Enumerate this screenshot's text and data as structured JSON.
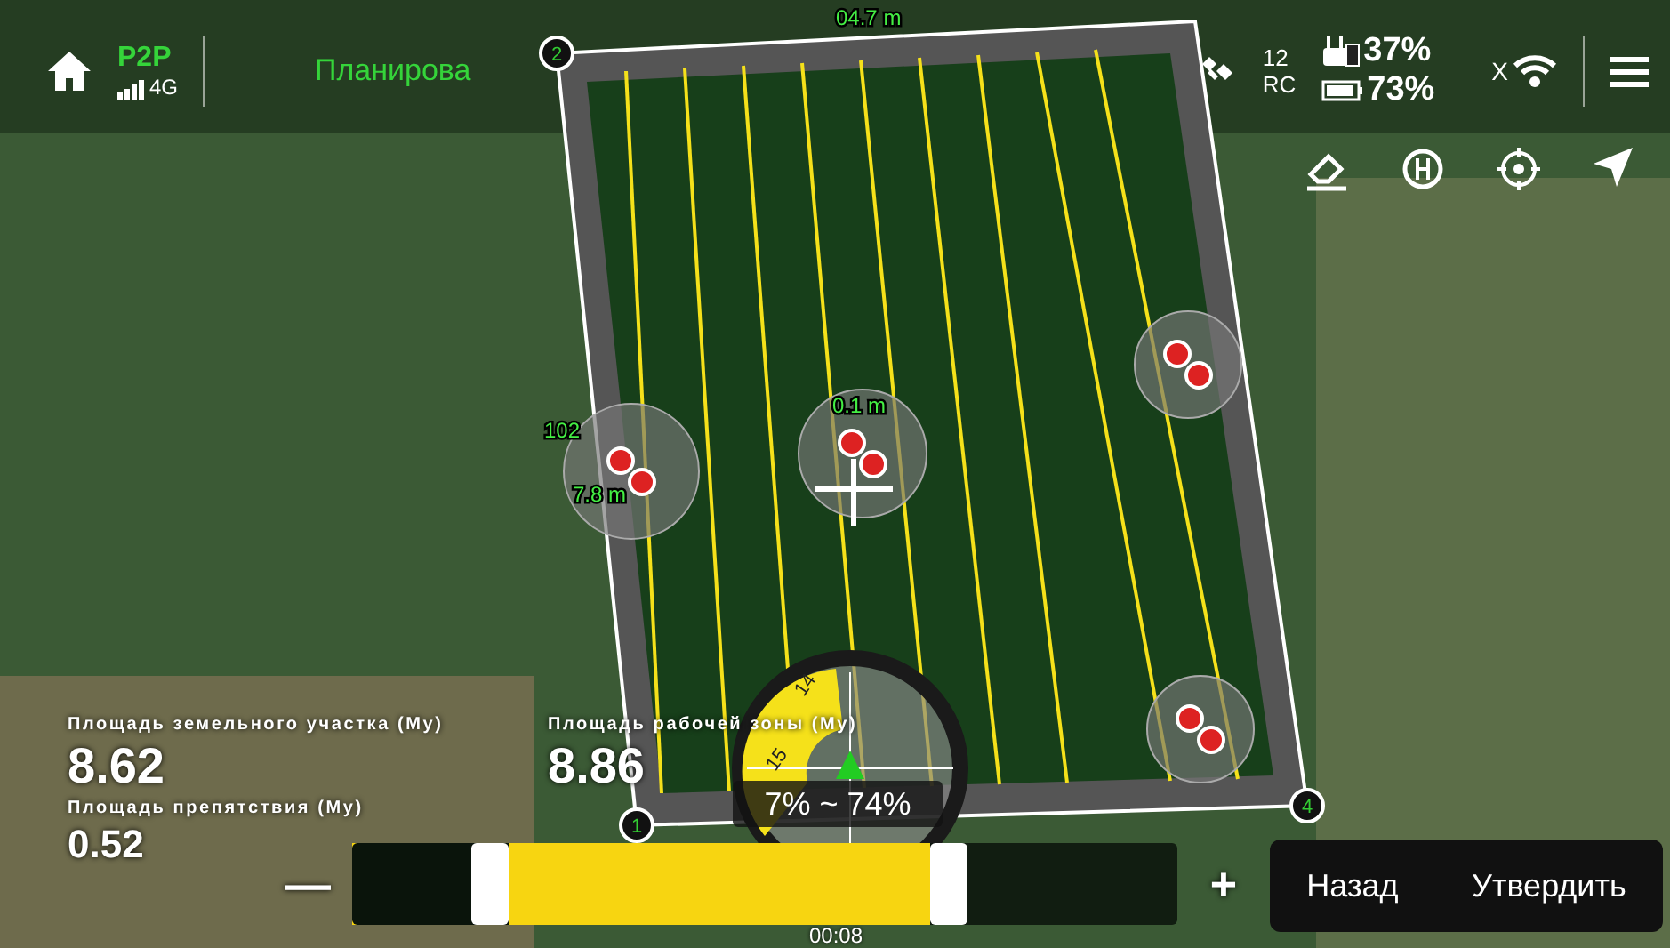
{
  "status_bar": {
    "link": "P2P",
    "network": "4G",
    "title": "Планирова",
    "satellites": "12",
    "rc_label": "RC",
    "rc_battery": "37%",
    "drone_battery": "73%",
    "wifi_prefix": "X"
  },
  "map": {
    "vertices": [
      {
        "label": "2"
      },
      {
        "label": "4"
      },
      {
        "label": "1"
      }
    ],
    "labels": [
      {
        "text": "7.8 m"
      },
      {
        "text": "0.1 m"
      },
      {
        "text": "102"
      },
      {
        "text": "04.7 m"
      }
    ]
  },
  "compass": {
    "ticks": [
      "14",
      "15"
    ],
    "range": "7% ~ 74%"
  },
  "stats": [
    {
      "label": "Площадь земельного участка (Му)",
      "value": "8.62"
    },
    {
      "label": "Площадь рабочей зоны (Му)",
      "value": "8.86"
    },
    {
      "label": "Площадь препятствия (Му)",
      "value": "0.52"
    }
  ],
  "slider": {
    "thumbs": [
      {
        "level": 0.19
      },
      {
        "level": 0.7
      }
    ],
    "minus": "—",
    "plus": "+",
    "time": "00:08"
  },
  "buttons": [
    {
      "label": "Назад"
    },
    {
      "label": "Утвердить"
    }
  ]
}
